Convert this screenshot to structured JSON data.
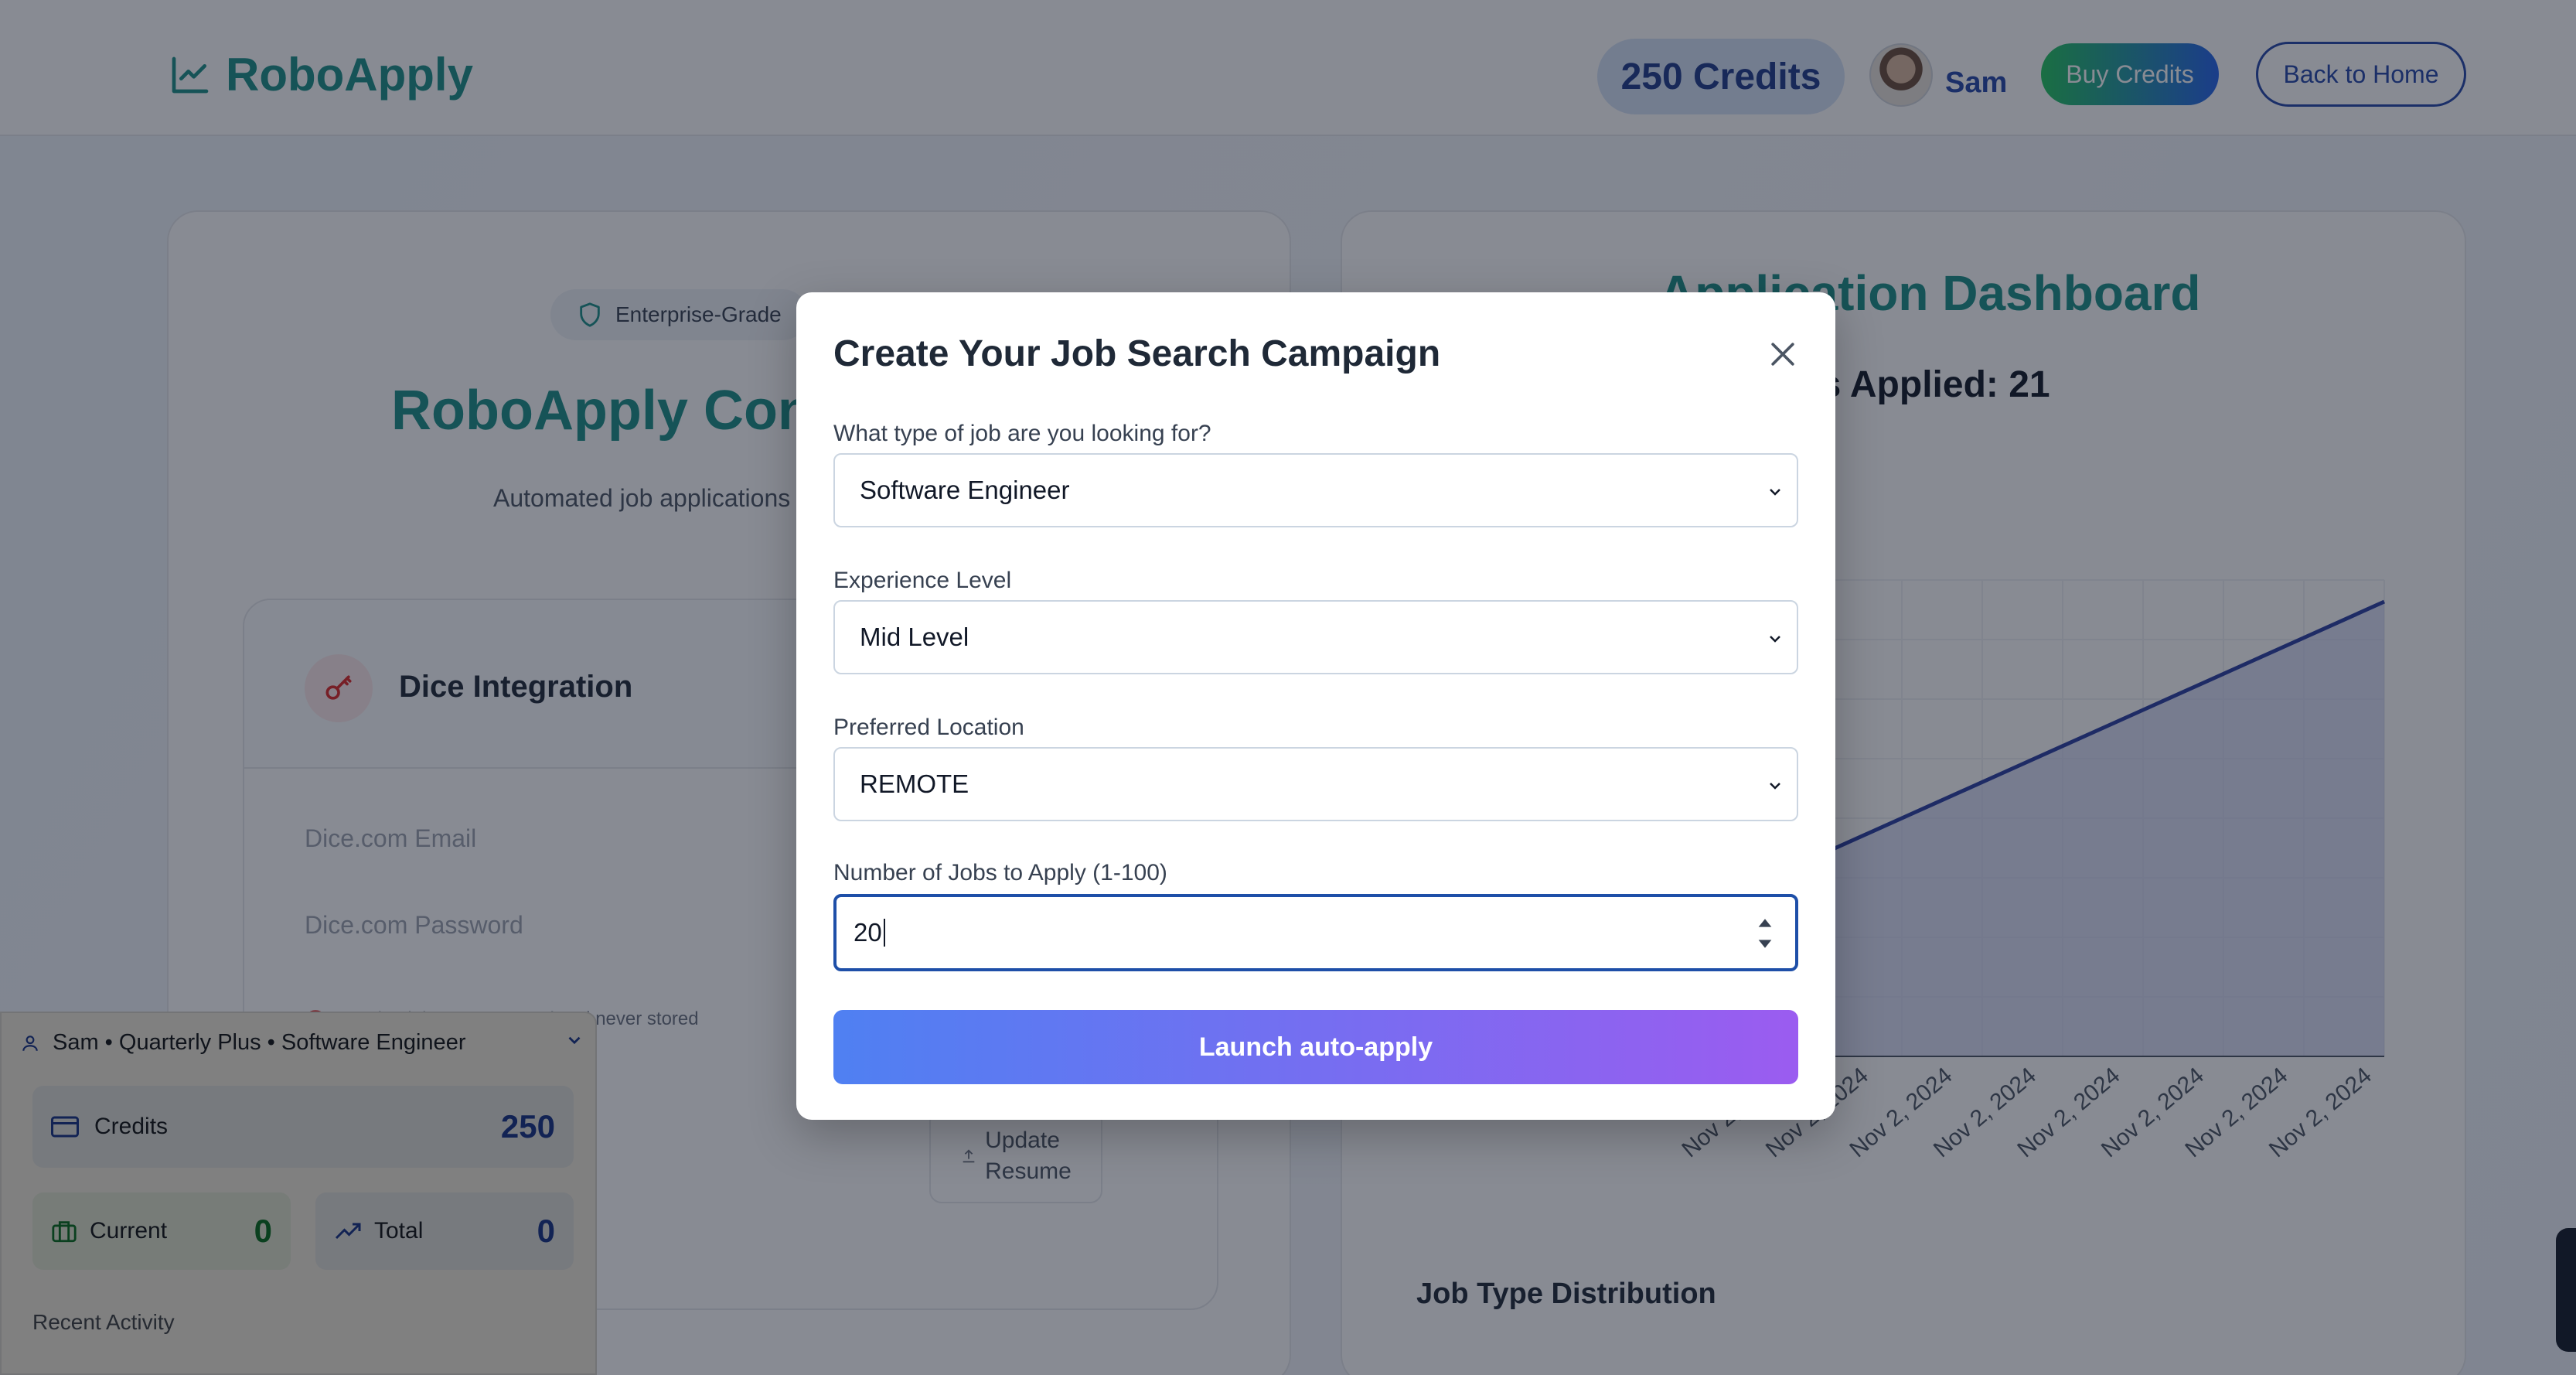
{
  "header": {
    "logo_text": "RoboApply",
    "credits_pill": "250 Credits",
    "user_name": "Sam",
    "buy_credits": "Buy Credits",
    "back_home": "Back to Home"
  },
  "left_card": {
    "badge": "Enterprise-Grade",
    "title": "RoboApply Con",
    "subtitle": "Automated job applications",
    "dice": {
      "title": "Dice Integration",
      "email_placeholder": "Dice.com Email",
      "password_placeholder": "Dice.com Password",
      "note": "Credentials are encrypted and never stored"
    },
    "update_resume_line1": "Update",
    "update_resume_line2": "Resume"
  },
  "dashboard": {
    "title": "Application Dashboard",
    "jobs_applied": "obs Applied: 21",
    "job_type_distribution": "Job Type Distribution"
  },
  "chart_data": {
    "type": "area",
    "title": "",
    "x_visible_tick_labels": [
      "Nov 2",
      "Nov 2",
      "Nov 2",
      "Nov 2",
      "Nov 2, 2024",
      "Nov 2, 2024",
      "Nov 2, 2024",
      "Nov 2, 2024",
      "Nov 2, 2024",
      "Nov 2, 2024",
      "Nov 2, 2024",
      "Nov 2, 2024"
    ],
    "series": [
      {
        "values": [
          1,
          3,
          5,
          7,
          9,
          11,
          13,
          15,
          17,
          19,
          21
        ]
      }
    ],
    "grid": true,
    "colors": {
      "line": "#2a3fa3",
      "fill": "#c7cdf0"
    }
  },
  "widget": {
    "header": "Sam • Quarterly Plus • Software Engineer",
    "credits_label": "Credits",
    "credits_value": "250",
    "current_label": "Current",
    "current_value": "0",
    "total_label": "Total",
    "total_value": "0",
    "recent_activity": "Recent Activity"
  },
  "modal": {
    "title": "Create Your Job Search Campaign",
    "job_type_label": "What type of job are you looking for?",
    "job_type_value": "Software Engineer",
    "experience_label": "Experience Level",
    "experience_value": "Mid Level",
    "location_label": "Preferred Location",
    "location_value": "REMOTE",
    "jobs_count_label": "Number of Jobs to Apply (1-100)",
    "jobs_count_value": "20",
    "launch_label": "Launch auto-apply"
  },
  "colors": {
    "brand_teal": "#1a8f86",
    "brand_blue": "#2446a8",
    "launch_gradient_start": "#4f80f2",
    "launch_gradient_end": "#9b5cf0"
  }
}
